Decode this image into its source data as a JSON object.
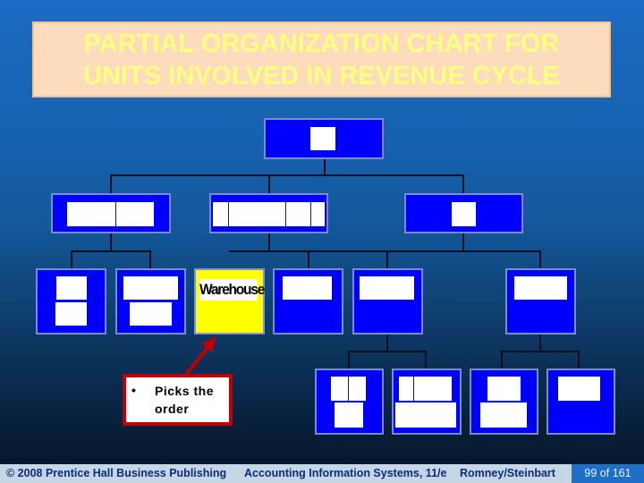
{
  "slide": {
    "title_lines": [
      "PARTIAL ORGANIZATION CHART FOR",
      "UNITS INVOLVED IN REVENUE CYCLE"
    ],
    "colors": {
      "title_bg": "#fddcbe",
      "title_text": "#ffff80",
      "node_fill": "#0000ff",
      "highlight_fill": "#ffff00",
      "callout_border": "#c00000",
      "footer_bg": "#c5d6e4",
      "page_badge_bg": "#1e6fc8"
    }
  },
  "org_chart": {
    "highlighted_node": {
      "label": "Warehouse"
    },
    "callout": {
      "bullet": "•",
      "lines": [
        "Picks the",
        "order"
      ]
    }
  },
  "footer": {
    "copyright": "© 2008 Prentice Hall Business Publishing",
    "book": "Accounting Information Systems, 11/e",
    "authors": "Romney/Steinbart",
    "page": "99 of 161"
  }
}
